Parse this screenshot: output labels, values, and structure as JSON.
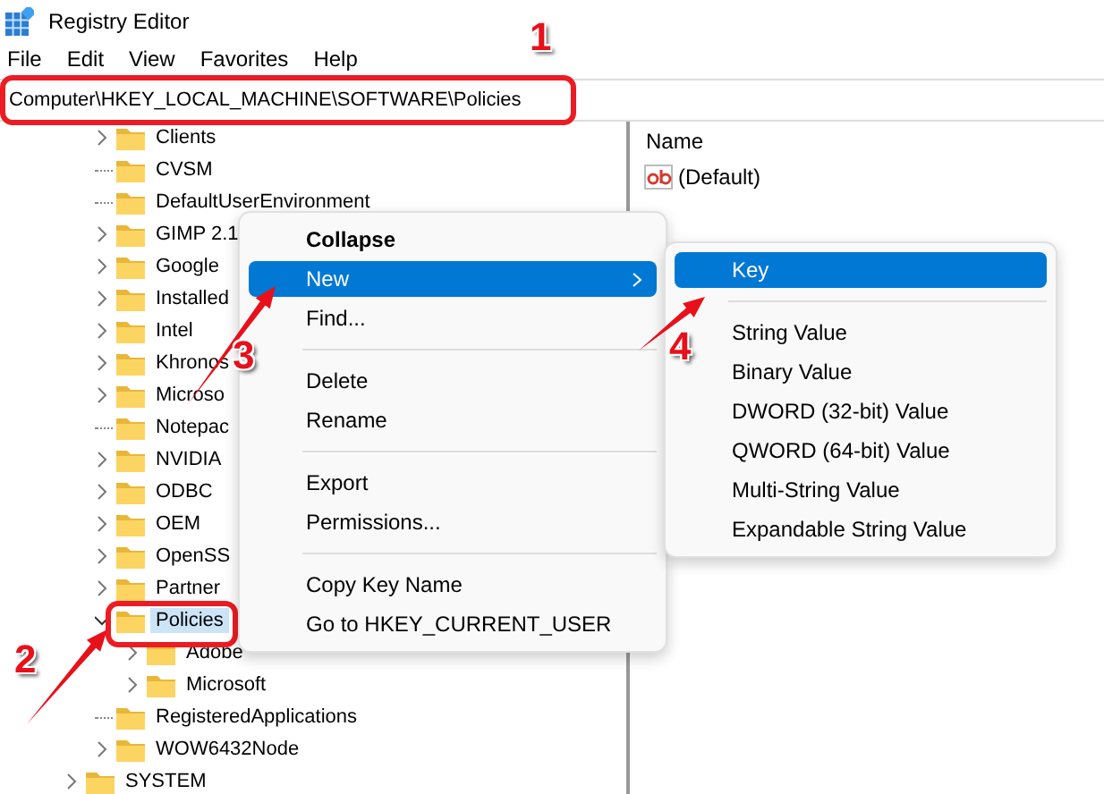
{
  "window": {
    "title": "Registry Editor"
  },
  "menu_bar": [
    "File",
    "Edit",
    "View",
    "Favorites",
    "Help"
  ],
  "address_bar": {
    "value": "Computer\\HKEY_LOCAL_MACHINE\\SOFTWARE\\Policies"
  },
  "tree": [
    {
      "children": [
        {
          "label": "Clients",
          "kind": "collapsed",
          "selected": false
        },
        {
          "label": "CVSM",
          "kind": "leaf",
          "selected": false
        },
        {
          "label": "DefaultUserEnvironment",
          "kind": "leaf",
          "selected": false
        },
        {
          "label": "GIMP 2.1",
          "kind": "collapsed",
          "selected": false
        },
        {
          "label": "Google",
          "kind": "collapsed",
          "selected": false
        },
        {
          "label": "Installed",
          "kind": "collapsed",
          "selected": false
        },
        {
          "label": "Intel",
          "kind": "collapsed",
          "selected": false
        },
        {
          "label": "Khronos",
          "kind": "collapsed",
          "selected": false
        },
        {
          "label": "Microso",
          "kind": "collapsed",
          "selected": false
        },
        {
          "label": "Notepac",
          "kind": "leaf",
          "selected": false
        },
        {
          "label": "NVIDIA",
          "kind": "collapsed",
          "selected": false
        },
        {
          "label": "ODBC",
          "kind": "collapsed",
          "selected": false
        },
        {
          "label": "OEM",
          "kind": "collapsed",
          "selected": false
        },
        {
          "label": "OpenSS",
          "kind": "collapsed",
          "selected": false
        },
        {
          "label": "Partner",
          "kind": "collapsed",
          "selected": false
        },
        {
          "label": "Policies",
          "kind": "expanded",
          "selected": true,
          "children": [
            {
              "label": "Adobe",
              "kind": "collapsed",
              "selected": false
            },
            {
              "label": "Microsoft",
              "kind": "collapsed",
              "selected": false
            }
          ]
        },
        {
          "label": "RegisteredApplications",
          "kind": "leaf",
          "selected": false
        },
        {
          "label": "WOW6432Node",
          "kind": "collapsed",
          "selected": false
        }
      ]
    },
    {
      "label": "SYSTEM",
      "kind": "collapsed",
      "selected": false
    }
  ],
  "values_pane": {
    "column": "Name",
    "rows": [
      {
        "name": "(Default)"
      }
    ]
  },
  "context_menu": [
    {
      "kind": "item",
      "label": "Collapse",
      "bold": true,
      "selected": false
    },
    {
      "kind": "submenu",
      "label": "New",
      "selected": true
    },
    {
      "kind": "item",
      "label": "Find...",
      "selected": false
    },
    {
      "kind": "separator"
    },
    {
      "kind": "item",
      "label": "Delete",
      "selected": false
    },
    {
      "kind": "item",
      "label": "Rename",
      "selected": false
    },
    {
      "kind": "separator"
    },
    {
      "kind": "item",
      "label": "Export",
      "selected": false
    },
    {
      "kind": "item",
      "label": "Permissions...",
      "selected": false
    },
    {
      "kind": "separator"
    },
    {
      "kind": "item",
      "label": "Copy Key Name",
      "selected": false
    },
    {
      "kind": "item",
      "label": "Go to HKEY_CURRENT_USER",
      "selected": false
    }
  ],
  "submenu": [
    {
      "kind": "item",
      "label": "Key",
      "selected": true
    },
    {
      "kind": "separator"
    },
    {
      "kind": "item",
      "label": "String Value",
      "selected": false
    },
    {
      "kind": "item",
      "label": "Binary Value",
      "selected": false
    },
    {
      "kind": "item",
      "label": "DWORD (32-bit) Value",
      "selected": false
    },
    {
      "kind": "item",
      "label": "QWORD (64-bit) Value",
      "selected": false
    },
    {
      "kind": "item",
      "label": "Multi-String Value",
      "selected": false
    },
    {
      "kind": "item",
      "label": "Expandable String Value",
      "selected": false
    }
  ],
  "annotations": [
    {
      "number": "1"
    },
    {
      "number": "2"
    },
    {
      "number": "3"
    },
    {
      "number": "4"
    }
  ]
}
